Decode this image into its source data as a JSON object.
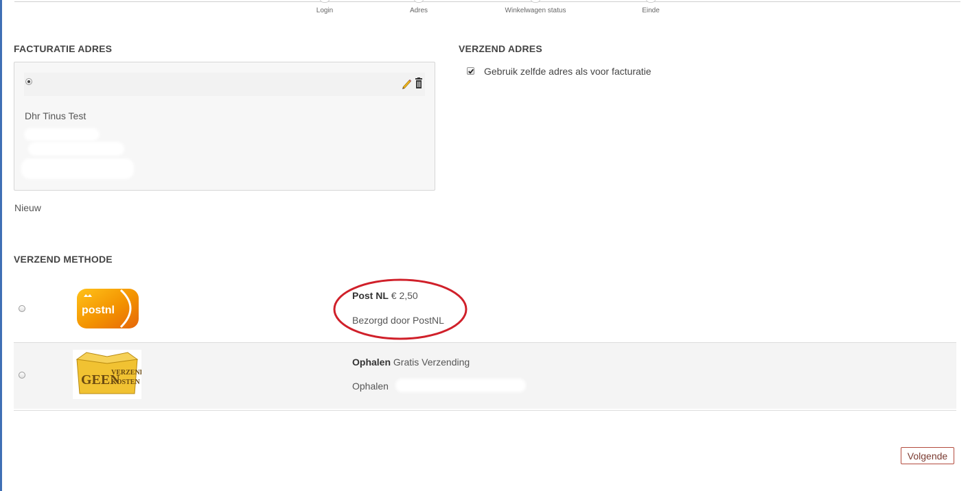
{
  "stepper": {
    "steps": [
      {
        "label": "Login"
      },
      {
        "label": "Adres"
      },
      {
        "label": "Winkelwagen status"
      },
      {
        "label": "Einde"
      }
    ]
  },
  "billing": {
    "title": "FACTURATIE ADRES",
    "address_name": "Dhr Tinus Test",
    "selected": true,
    "new_label": "Nieuw"
  },
  "shipping_address": {
    "title": "VERZEND ADRES",
    "same_as_billing_label": "Gebruik zelfde adres als voor facturatie",
    "same_as_billing_checked": true
  },
  "shipping_method": {
    "title": "VERZEND METHODE",
    "options": [
      {
        "name": "Post NL",
        "price": "€ 2,50",
        "description": "Bezorgd door PostNL",
        "logo_text": "postnl",
        "icon": "postnl-logo"
      },
      {
        "name": "Ophalen",
        "price": "Gratis Verzending",
        "description": "Ophalen",
        "logo_text_1": "GEEN",
        "logo_text_2": "VERZEND",
        "logo_text_3": "KOSTEN",
        "icon": "geen-verzendkosten-box"
      }
    ]
  },
  "colors": {
    "accent_left_border": "#3f6fb5",
    "annotation_red": "#d0202a",
    "postnl_orange": "#f39200",
    "button_border": "#b24a3c"
  },
  "actions": {
    "next_label": "Volgende"
  }
}
